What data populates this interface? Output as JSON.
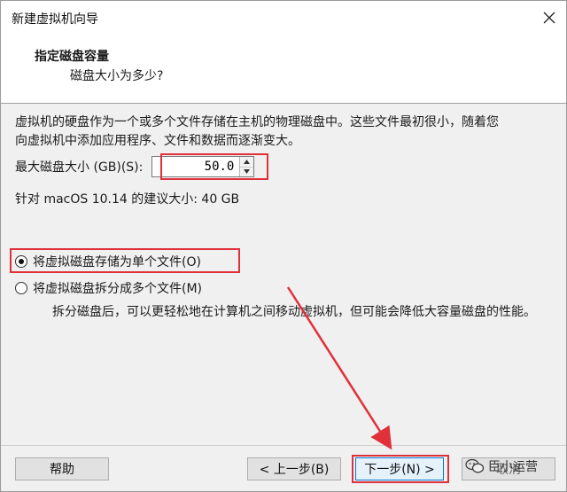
{
  "window": {
    "title": "新建虚拟机向导"
  },
  "header": {
    "title": "指定磁盘容量",
    "subtitle": "磁盘大小为多少?"
  },
  "description": {
    "line1": "虚拟机的硬盘作为一个或多个文件存储在主机的物理磁盘中。这些文件最初很小，随着您",
    "line2": "向虚拟机中添加应用程序、文件和数据而逐渐变大。"
  },
  "disk_size": {
    "label": "最大磁盘大小 (GB)(S):",
    "value": "50.0"
  },
  "recommendation": "针对 macOS 10.14 的建议大小: 40 GB",
  "options": [
    {
      "label": "将虚拟磁盘存储为单个文件(O)",
      "selected": true
    },
    {
      "label": "将虚拟磁盘拆分成多个文件(M)",
      "selected": false
    }
  ],
  "split_note": "拆分磁盘后，可以更轻松地在计算机之间移动虚拟机，但可能会降低大容量磁盘的性能。",
  "buttons": {
    "help": "帮助",
    "back": "< 上一步(B)",
    "next": "下一步(N) >",
    "cancel": "取消"
  },
  "watermark": "臣小运营",
  "colors": {
    "highlight": "#e0313a",
    "accent": "#0078d7"
  }
}
